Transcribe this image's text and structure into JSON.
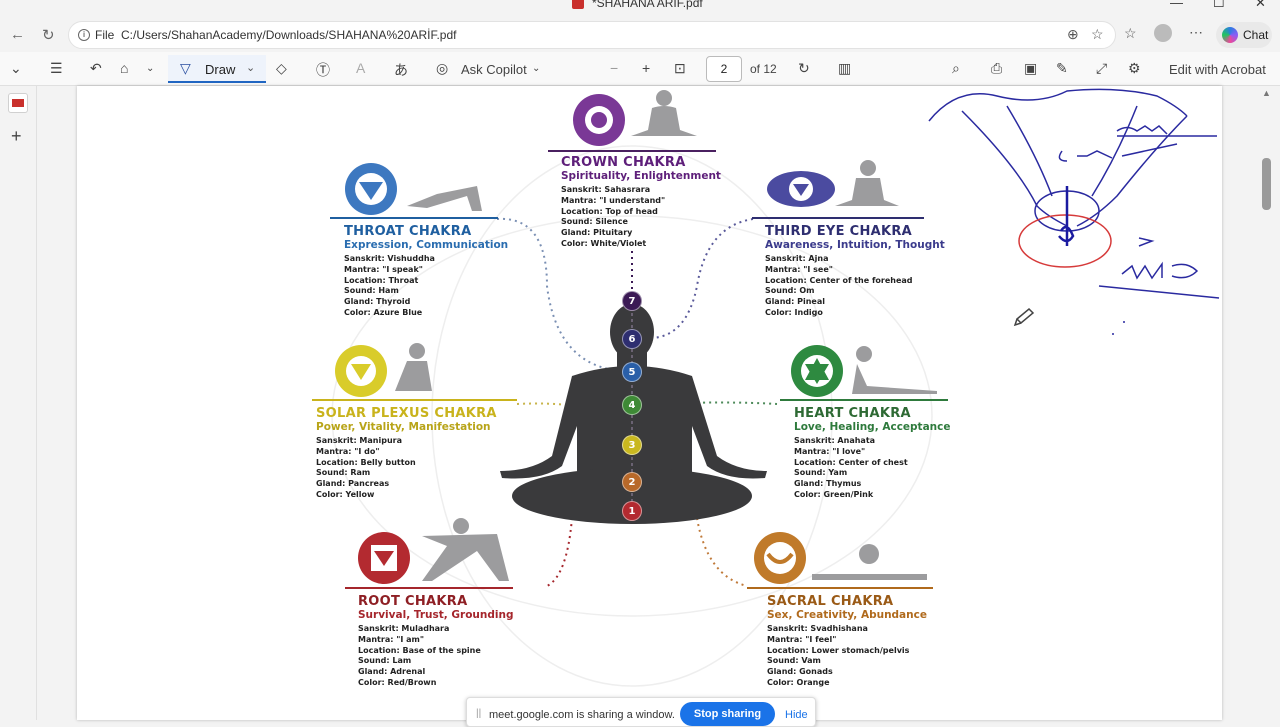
{
  "window": {
    "title": "*SHAHANA ARİF.pdf"
  },
  "address_bar": {
    "protocol_label": "File",
    "url": "C:/Users/ShahanAcademy/Downloads/SHAHANA%20ARİF.pdf",
    "chat_label": "Chat"
  },
  "toolbar": {
    "draw_label": "Draw",
    "ask_copilot_label": "Ask Copilot",
    "page_current": "2",
    "page_total": "of 12",
    "edit_acrobat_label": "Edit with Acrobat"
  },
  "chakras": {
    "crown": {
      "title": "CROWN CHAKRA",
      "subtitle": "Spirituality, Enlightenment",
      "rows": [
        "Sanskrit: Sahasrara",
        "Mantra: \"I understand\"",
        "Location: Top of head",
        "Sound: Silence",
        "Gland: Pituitary",
        "Color: White/Violet"
      ],
      "color": "#6b2a86"
    },
    "throat": {
      "title": "THROAT CHAKRA",
      "subtitle": "Expression, Communication",
      "rows": [
        "Sanskrit: Vishuddha",
        "Mantra: \"I speak\"",
        "Location: Throat",
        "Sound: Ham",
        "Gland: Thyroid",
        "Color: Azure Blue"
      ],
      "color": "#1f5fa0"
    },
    "third_eye": {
      "title": "THIRD EYE CHAKRA",
      "subtitle": "Awareness, Intuition, Thought",
      "rows": [
        "Sanskrit: Ajna",
        "Mantra: \"I see\"",
        "Location: Center of the forehead",
        "Sound: Om",
        "Gland: Pineal",
        "Color: Indigo"
      ],
      "color": "#3b3b8c"
    },
    "solar_plexus": {
      "title": "SOLAR PLEXUS CHAKRA",
      "subtitle": "Power, Vitality, Manifestation",
      "rows": [
        "Sanskrit: Manipura",
        "Mantra: \"I do\"",
        "Location: Belly button",
        "Sound: Ram",
        "Gland: Pancreas",
        "Color: Yellow"
      ],
      "color": "#c9b31c"
    },
    "heart": {
      "title": "HEART CHAKRA",
      "subtitle": "Love, Healing, Acceptance",
      "rows": [
        "Sanskrit: Anahata",
        "Mantra: \"I love\"",
        "Location: Center of chest",
        "Sound: Yam",
        "Gland: Thymus",
        "Color: Green/Pink"
      ],
      "color": "#2e7a3c"
    },
    "root": {
      "title": "ROOT CHAKRA",
      "subtitle": "Survival, Trust, Grounding",
      "rows": [
        "Sanskrit: Muladhara",
        "Mantra: \"I am\"",
        "Location: Base of the spine",
        "Sound: Lam",
        "Gland: Adrenal",
        "Color: Red/Brown"
      ],
      "color": "#a5262c"
    },
    "sacral": {
      "title": "SACRAL CHAKRA",
      "subtitle": "Sex, Creativity, Abundance",
      "rows": [
        "Sanskrit: Svadhishana",
        "Mantra: \"I feel\"",
        "Location: Lower stomach/pelvis",
        "Sound: Vam",
        "Gland: Gonads",
        "Color: Orange"
      ],
      "color": "#b06a1c"
    }
  },
  "nodes": [
    "7",
    "6",
    "5",
    "4",
    "3",
    "2",
    "1"
  ],
  "screen_share": {
    "message": "meet.google.com is sharing a window.",
    "stop_label": "Stop sharing",
    "hide_label": "Hide"
  }
}
